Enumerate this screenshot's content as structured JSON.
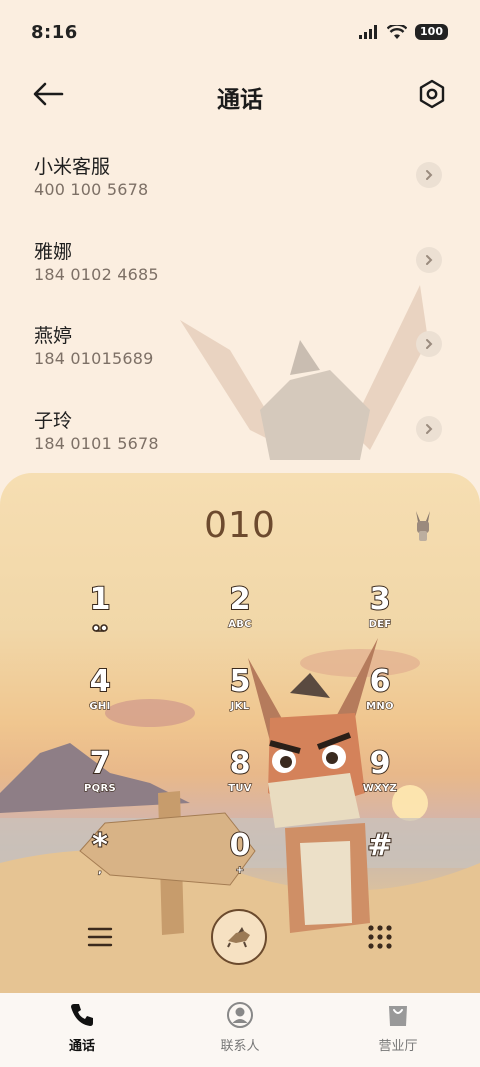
{
  "status_bar": {
    "time": "8:16",
    "battery": "100"
  },
  "header": {
    "title": "通话"
  },
  "contacts": [
    {
      "name": "小米客服",
      "number": "400 100 5678"
    },
    {
      "name": "雅娜",
      "number": "184 0102 4685"
    },
    {
      "name": "燕婷",
      "number": "184 01015689"
    },
    {
      "name": "子玲",
      "number": "184 0101 5678"
    }
  ],
  "dialer": {
    "current_number": "010",
    "keys": [
      {
        "digit": "1",
        "letters": ""
      },
      {
        "digit": "2",
        "letters": "ABC"
      },
      {
        "digit": "3",
        "letters": "DEF"
      },
      {
        "digit": "4",
        "letters": "GHI"
      },
      {
        "digit": "5",
        "letters": "JKL"
      },
      {
        "digit": "6",
        "letters": "MNO"
      },
      {
        "digit": "7",
        "letters": "PQRS"
      },
      {
        "digit": "8",
        "letters": "TUV"
      },
      {
        "digit": "9",
        "letters": "WXYZ"
      },
      {
        "digit": "*",
        "letters": ","
      },
      {
        "digit": "0",
        "letters": "+"
      },
      {
        "digit": "#",
        "letters": ""
      }
    ]
  },
  "tabs": [
    {
      "label": "通话",
      "icon": "phone-icon",
      "active": true
    },
    {
      "label": "联系人",
      "icon": "person-icon",
      "active": false
    },
    {
      "label": "营业厅",
      "icon": "shopping-bag-icon",
      "active": false
    }
  ],
  "colors": {
    "accent": "#6b4a2d",
    "panel": "#f6deb2",
    "background": "#fbeee0"
  }
}
